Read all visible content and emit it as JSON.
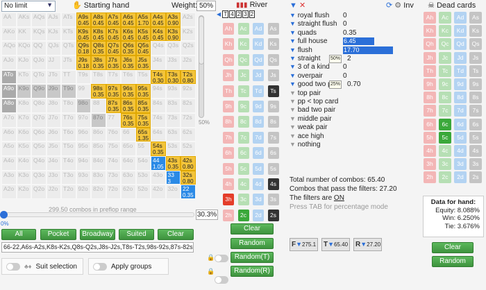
{
  "toolbar": {
    "game_type": "No limit",
    "starting_hand_label": "Starting hand",
    "weight_label": "Weight:",
    "weight_value": "50%",
    "river_label": "River",
    "inv_label": "Inv",
    "dead_cards_label": "Dead cards",
    "board_mini": [
      "T",
      "4",
      "2",
      "3",
      "2"
    ]
  },
  "matrix": [
    [
      [
        "AA",
        ""
      ],
      [
        "AKs",
        ""
      ],
      [
        "AQs",
        ""
      ],
      [
        "AJs",
        ""
      ],
      [
        "ATs",
        ""
      ],
      [
        "A9s",
        "0.45"
      ],
      [
        "A8s",
        "0.45"
      ],
      [
        "A7s",
        "0.45"
      ],
      [
        "A6s",
        "0.45"
      ],
      [
        "A5s",
        "1.70"
      ],
      [
        "A4s",
        "0.45"
      ],
      [
        "A3s",
        "0.90"
      ],
      [
        "A2s",
        ""
      ]
    ],
    [
      [
        "AKo",
        ""
      ],
      [
        "KK",
        ""
      ],
      [
        "KQs",
        ""
      ],
      [
        "KJs",
        ""
      ],
      [
        "KTs",
        ""
      ],
      [
        "K9s",
        "0.45"
      ],
      [
        "K8s",
        "0.45"
      ],
      [
        "K7s",
        "0.45"
      ],
      [
        "K6s",
        "0.45"
      ],
      [
        "K5s",
        "0.45"
      ],
      [
        "K4s",
        "0.45"
      ],
      [
        "K3s",
        "0.90"
      ],
      [
        "K2s",
        ""
      ]
    ],
    [
      [
        "AQo",
        ""
      ],
      [
        "KQo",
        ""
      ],
      [
        "QQ",
        ""
      ],
      [
        "QJs",
        ""
      ],
      [
        "QTs",
        ""
      ],
      [
        "Q9s",
        "0.18"
      ],
      [
        "Q8s",
        "0.35"
      ],
      [
        "Q7s",
        "0.45"
      ],
      [
        "Q6s",
        "0.35"
      ],
      [
        "Q5s",
        "0.45"
      ],
      [
        "Q4s",
        ""
      ],
      [
        "Q3s",
        ""
      ],
      [
        "Q2s",
        ""
      ]
    ],
    [
      [
        "AJo",
        ""
      ],
      [
        "KJo",
        ""
      ],
      [
        "QJo",
        ""
      ],
      [
        "JJ",
        ""
      ],
      [
        "JTs",
        ""
      ],
      [
        "J9s",
        "0.18"
      ],
      [
        "J8s",
        "0.35"
      ],
      [
        "J7s",
        "0.35"
      ],
      [
        "J6s",
        "0.35"
      ],
      [
        "J5s",
        "0.35"
      ],
      [
        "J4s",
        ""
      ],
      [
        "J3s",
        ""
      ],
      [
        "J2s",
        ""
      ]
    ],
    [
      [
        "ATo",
        ""
      ],
      [
        "KTo",
        ""
      ],
      [
        "QTo",
        ""
      ],
      [
        "JTo",
        ""
      ],
      [
        "TT",
        ""
      ],
      [
        "T9s",
        ""
      ],
      [
        "T8s",
        ""
      ],
      [
        "T7s",
        ""
      ],
      [
        "T6s",
        ""
      ],
      [
        "T5s",
        ""
      ],
      [
        "T4s",
        "0.30"
      ],
      [
        "T3s",
        "0.30"
      ],
      [
        "T2s",
        "0.80"
      ]
    ],
    [
      [
        "A9o",
        ""
      ],
      [
        "K9o",
        ""
      ],
      [
        "Q9o",
        ""
      ],
      [
        "J9o",
        ""
      ],
      [
        "T9o",
        ""
      ],
      [
        "99",
        ""
      ],
      [
        "98s",
        "0.35"
      ],
      [
        "97s",
        "0.35"
      ],
      [
        "96s",
        "0.35"
      ],
      [
        "95s",
        "0.35"
      ],
      [
        "94s",
        ""
      ],
      [
        "93s",
        ""
      ],
      [
        "92s",
        ""
      ]
    ],
    [
      [
        "A8o",
        ""
      ],
      [
        "K8o",
        ""
      ],
      [
        "Q8o",
        ""
      ],
      [
        "J8o",
        ""
      ],
      [
        "T8o",
        ""
      ],
      [
        "98o",
        ""
      ],
      [
        "88",
        ""
      ],
      [
        "87s",
        "0.35"
      ],
      [
        "86s",
        "0.35"
      ],
      [
        "85s",
        "0.35"
      ],
      [
        "84s",
        ""
      ],
      [
        "83s",
        ""
      ],
      [
        "82s",
        ""
      ]
    ],
    [
      [
        "A7o",
        ""
      ],
      [
        "K7o",
        ""
      ],
      [
        "Q7o",
        ""
      ],
      [
        "J7o",
        ""
      ],
      [
        "T7o",
        ""
      ],
      [
        "97o",
        ""
      ],
      [
        "87o",
        ""
      ],
      [
        "77",
        ""
      ],
      [
        "76s",
        "0.35"
      ],
      [
        "75s",
        "0.35"
      ],
      [
        "74s",
        ""
      ],
      [
        "73s",
        ""
      ],
      [
        "72s",
        ""
      ]
    ],
    [
      [
        "A6o",
        ""
      ],
      [
        "K6o",
        ""
      ],
      [
        "Q6o",
        ""
      ],
      [
        "J6o",
        ""
      ],
      [
        "T6o",
        ""
      ],
      [
        "96o",
        ""
      ],
      [
        "86o",
        ""
      ],
      [
        "76o",
        ""
      ],
      [
        "66",
        ""
      ],
      [
        "65s",
        "1.35"
      ],
      [
        "64s",
        ""
      ],
      [
        "63s",
        ""
      ],
      [
        "62s",
        ""
      ]
    ],
    [
      [
        "A5o",
        ""
      ],
      [
        "K5o",
        ""
      ],
      [
        "Q5o",
        ""
      ],
      [
        "J5o",
        ""
      ],
      [
        "T5o",
        ""
      ],
      [
        "95o",
        ""
      ],
      [
        "85o",
        ""
      ],
      [
        "75o",
        ""
      ],
      [
        "65o",
        ""
      ],
      [
        "55",
        ""
      ],
      [
        "54s",
        "0.35"
      ],
      [
        "53s",
        ""
      ],
      [
        "52s",
        ""
      ]
    ],
    [
      [
        "A4o",
        ""
      ],
      [
        "K4o",
        ""
      ],
      [
        "Q4o",
        ""
      ],
      [
        "J4o",
        ""
      ],
      [
        "T4o",
        ""
      ],
      [
        "94o",
        ""
      ],
      [
        "84o",
        ""
      ],
      [
        "74o",
        ""
      ],
      [
        "64o",
        ""
      ],
      [
        "54o",
        ""
      ],
      [
        "44",
        "1.05"
      ],
      [
        "43s",
        "0.35"
      ],
      [
        "42s",
        "0.80"
      ]
    ],
    [
      [
        "A3o",
        ""
      ],
      [
        "K3o",
        ""
      ],
      [
        "Q3o",
        ""
      ],
      [
        "J3o",
        ""
      ],
      [
        "T3o",
        ""
      ],
      [
        "93o",
        ""
      ],
      [
        "83o",
        ""
      ],
      [
        "73o",
        ""
      ],
      [
        "63o",
        ""
      ],
      [
        "53o",
        ""
      ],
      [
        "43o",
        ""
      ],
      [
        "33",
        "3"
      ],
      [
        "32s",
        "0.80"
      ]
    ],
    [
      [
        "A2o",
        ""
      ],
      [
        "K2o",
        ""
      ],
      [
        "Q2o",
        ""
      ],
      [
        "J2o",
        ""
      ],
      [
        "T2o",
        ""
      ],
      [
        "92o",
        ""
      ],
      [
        "82o",
        ""
      ],
      [
        "72o",
        ""
      ],
      [
        "62o",
        ""
      ],
      [
        "52o",
        ""
      ],
      [
        "42o",
        ""
      ],
      [
        "32o",
        ""
      ],
      [
        "22",
        "0.35"
      ]
    ]
  ],
  "slider_label": "50%",
  "combos_in_range": "299.50 combos in preflop range",
  "range_pct": "30.3%",
  "range_pct_value": 0.303,
  "zero_label": "0%",
  "buttons": {
    "all": "All",
    "pocket": "Pocket",
    "broadway": "Broadway",
    "suited": "Suited",
    "clear": "Clear",
    "board_clear": "Clear",
    "board_random": "Random",
    "board_random_t": "Random(T)",
    "board_random_r": "Random(R)",
    "dead_clear": "Clear",
    "dead_random": "Random"
  },
  "range_text": "66-22,A6s-A2s,K8s-K2s,Q8s-Q2s,J8s-J2s,T8s-T2s,98s-92s,87s-82s,7",
  "suit_selection": "Suit selection",
  "apply_groups": "Apply groups",
  "board": {
    "ranks": [
      "A",
      "K",
      "Q",
      "J",
      "T",
      "9",
      "8",
      "7",
      "6",
      "5",
      "4",
      "3",
      "2"
    ],
    "selected": {
      "Ts": true,
      "4s": true,
      "3h": true,
      "2c": true,
      "2s": true
    }
  },
  "filters": [
    {
      "name": "royal flush",
      "value": "0",
      "active": true
    },
    {
      "name": "straight flush",
      "value": "0",
      "active": true
    },
    {
      "name": "quads",
      "value": "0.35",
      "active": true
    },
    {
      "name": "full house",
      "value": "6.45",
      "active": true
    },
    {
      "name": "flush",
      "value": "17.70",
      "active": true
    },
    {
      "name": "straight",
      "value": "2",
      "active": true,
      "badge": "50%"
    },
    {
      "name": "3 of a kind",
      "value": "0",
      "active": true
    },
    {
      "name": "overpair",
      "value": "0",
      "active": true
    },
    {
      "name": "good two pair",
      "value": "0.70",
      "active": true,
      "badge": "25%"
    },
    {
      "name": "top pair",
      "value": "",
      "active": false
    },
    {
      "name": "pp < top card",
      "value": "",
      "active": false
    },
    {
      "name": "bad two pair",
      "value": "",
      "active": false
    },
    {
      "name": "middle pair",
      "value": "",
      "active": false
    },
    {
      "name": "weak pair",
      "value": "",
      "active": false
    },
    {
      "name": "ace high",
      "value": "",
      "active": false
    },
    {
      "name": "nothing",
      "value": "",
      "active": false
    }
  ],
  "summary": {
    "total": "Total number of combos: 65.40",
    "pass": "Combos that pass the filters: 27.20",
    "filters_on_prefix": "The filters are ",
    "filters_on": "ON",
    "tab_hint": "Press TAB for percentage mode"
  },
  "filter_boxes": [
    {
      "letter": "F",
      "value": "275.1"
    },
    {
      "letter": "T",
      "value": "65.40"
    },
    {
      "letter": "R",
      "value": "27.20"
    }
  ],
  "dead": {
    "selected": [
      "6c",
      "5c"
    ]
  },
  "data_for_hand": {
    "title": "Data for hand:",
    "equity": "Equity: 8.088%",
    "win": "Win: 6.250%",
    "tie": "Tie: 3.676%"
  },
  "colors": {
    "yellow": "#f3c43b",
    "blue": "#2b8ae6",
    "green": "#3e933e"
  }
}
